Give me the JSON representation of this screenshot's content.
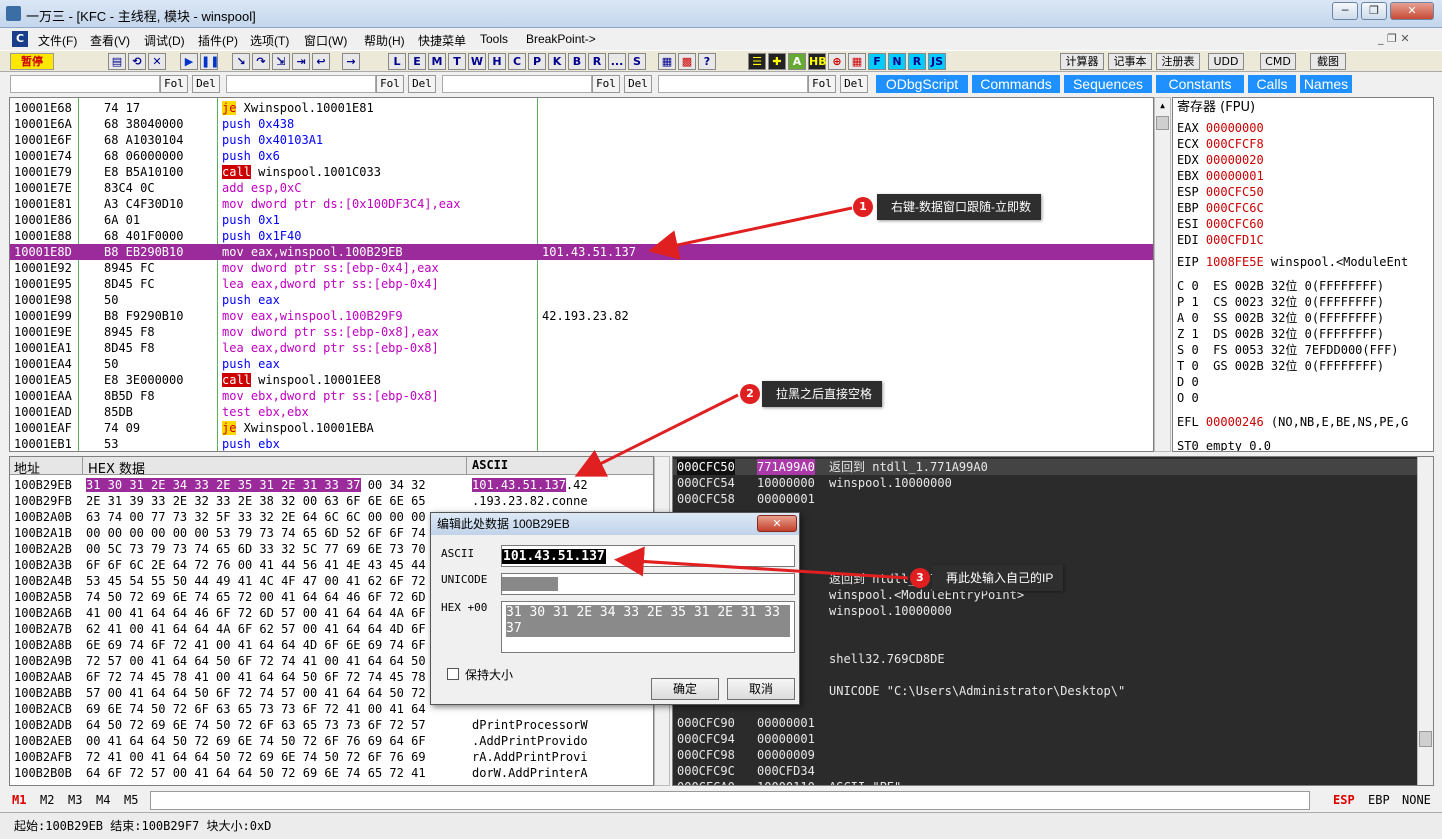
{
  "window": {
    "title": "一万三 - [KFC - 主线程, 模块 - winspool]"
  },
  "menubar": {
    "items": [
      "文件(F)",
      "查看(V)",
      "调试(D)",
      "插件(P)",
      "选项(T)",
      "窗口(W)",
      "帮助(H)",
      "快捷菜单",
      "Tools",
      "BreakPoint->"
    ]
  },
  "toolbar": {
    "pause_label": "暂停",
    "letters": [
      "L",
      "E",
      "M",
      "T",
      "W",
      "H",
      "C",
      "P",
      "K",
      "B",
      "R",
      "...",
      "S"
    ],
    "right_buttons": [
      "计算器",
      "记事本",
      "注册表",
      "UDD",
      "CMD",
      "截图"
    ],
    "fnrjs": [
      "F",
      "N",
      "R",
      "JS"
    ]
  },
  "bookmarks": {
    "fol": "Fol",
    "del": "Del",
    "plugins": [
      "ODbgScript",
      "Commands",
      "Sequences",
      "Constants",
      "Calls",
      "Names"
    ]
  },
  "disasm": {
    "rows": [
      {
        "addr": "10001E68",
        "hex": "74 17",
        "asm": "je Xwinspool.10001E81",
        "comment": ""
      },
      {
        "addr": "10001E6A",
        "hex": "68 38040000",
        "asm": "push 0x438",
        "comment": ""
      },
      {
        "addr": "10001E6F",
        "hex": "68 A1030104",
        "asm": "push 0x40103A1",
        "comment": ""
      },
      {
        "addr": "10001E74",
        "hex": "68 06000000",
        "asm": "push 0x6",
        "comment": ""
      },
      {
        "addr": "10001E79",
        "hex": "E8 B5A10100",
        "asm": "call winspool.1001C033",
        "comment": ""
      },
      {
        "addr": "10001E7E",
        "hex": "83C4 0C",
        "asm": "add esp,0xC",
        "comment": ""
      },
      {
        "addr": "10001E81",
        "hex": "A3 C4F30D10",
        "asm": "mov dword ptr ds:[0x100DF3C4],eax",
        "comment": ""
      },
      {
        "addr": "10001E86",
        "hex": "6A 01",
        "asm": "push 0x1",
        "comment": ""
      },
      {
        "addr": "10001E88",
        "hex": "68 401F0000",
        "asm": "push 0x1F40",
        "comment": ""
      },
      {
        "addr": "10001E8D",
        "hex": "B8 EB290B10",
        "asm": "mov eax,winspool.100B29EB",
        "comment": "101.43.51.137"
      },
      {
        "addr": "10001E92",
        "hex": "8945 FC",
        "asm": "mov dword ptr ss:[ebp-0x4],eax",
        "comment": ""
      },
      {
        "addr": "10001E95",
        "hex": "8D45 FC",
        "asm": "lea eax,dword ptr ss:[ebp-0x4]",
        "comment": ""
      },
      {
        "addr": "10001E98",
        "hex": "50",
        "asm": "push eax",
        "comment": ""
      },
      {
        "addr": "10001E99",
        "hex": "B8 F9290B10",
        "asm": "mov eax,winspool.100B29F9",
        "comment": "42.193.23.82"
      },
      {
        "addr": "10001E9E",
        "hex": "8945 F8",
        "asm": "mov dword ptr ss:[ebp-0x8],eax",
        "comment": ""
      },
      {
        "addr": "10001EA1",
        "hex": "8D45 F8",
        "asm": "lea eax,dword ptr ss:[ebp-0x8]",
        "comment": ""
      },
      {
        "addr": "10001EA4",
        "hex": "50",
        "asm": "push eax",
        "comment": ""
      },
      {
        "addr": "10001EA5",
        "hex": "E8 3E000000",
        "asm": "call winspool.10001EE8",
        "comment": ""
      },
      {
        "addr": "10001EAA",
        "hex": "8B5D F8",
        "asm": "mov ebx,dword ptr ss:[ebp-0x8]",
        "comment": ""
      },
      {
        "addr": "10001EAD",
        "hex": "85DB",
        "asm": "test ebx,ebx",
        "comment": ""
      },
      {
        "addr": "10001EAF",
        "hex": "74 09",
        "asm": "je Xwinspool.10001EBA",
        "comment": ""
      },
      {
        "addr": "10001EB1",
        "hex": "53",
        "asm": "push ebx",
        "comment": ""
      }
    ]
  },
  "registers": {
    "title": "寄存器 (FPU)",
    "gp": [
      {
        "name": "EAX",
        "val": "00000000"
      },
      {
        "name": "ECX",
        "val": "000CFCF8"
      },
      {
        "name": "EDX",
        "val": "00000020"
      },
      {
        "name": "EBX",
        "val": "00000001"
      },
      {
        "name": "ESP",
        "val": "000CFC50"
      },
      {
        "name": "EBP",
        "val": "000CFC6C"
      },
      {
        "name": "ESI",
        "val": "000CFC60"
      },
      {
        "name": "EDI",
        "val": "000CFD1C"
      }
    ],
    "eip": {
      "name": "EIP",
      "val": "1008FE5E",
      "extra": "winspool.<ModuleEnt"
    },
    "flags": [
      "C 0  ES 002B 32位 0(FFFFFFFF)",
      "P 1  CS 0023 32位 0(FFFFFFFF)",
      "A 0  SS 002B 32位 0(FFFFFFFF)",
      "Z 1  DS 002B 32位 0(FFFFFFFF)",
      "S 0  FS 0053 32位 7EFDD000(FFF)",
      "T 0  GS 002B 32位 0(FFFFFFFF)",
      "D 0",
      "O 0"
    ],
    "efl": {
      "name": "EFL",
      "val": "00000246",
      "extra": "(NO,NB,E,BE,NS,PE,G"
    },
    "st0": "ST0 empty 0.0"
  },
  "hexdump": {
    "headers": {
      "addr": "地址",
      "hex": "HEX 数据",
      "ascii": "ASCII"
    },
    "rows": [
      {
        "addr": "100B29EB",
        "hex": "31 30 31 2E 34 33 2E 35 31 2E 31 33 37 00 34 32",
        "ascii": "101.43.51.137.42"
      },
      {
        "addr": "100B29FB",
        "hex": "2E 31 39 33 2E 32 33 2E 38 32 00 63 6F 6E 6E 65",
        "ascii": ".193.23.82.conne"
      },
      {
        "addr": "100B2A0B",
        "hex": "63 74 00 77 73 32 5F 33 32 2E 64 6C 6C 00 00 00",
        "ascii": ""
      },
      {
        "addr": "100B2A1B",
        "hex": "00 00 00 00 00 00 53 79 73 74 65 6D 52 6F 6F 74",
        "ascii": ""
      },
      {
        "addr": "100B2A2B",
        "hex": "00 5C 73 79 73 74 65 6D 33 32 5C 77 69 6E 73 70",
        "ascii": ""
      },
      {
        "addr": "100B2A3B",
        "hex": "6F 6F 6C 2E 64 72 76 00 41 44 56 41 4E 43 45 44",
        "ascii": ""
      },
      {
        "addr": "100B2A4B",
        "hex": "53 45 54 55 50 44 49 41 4C 4F 47 00 41 62 6F 72",
        "ascii": ""
      },
      {
        "addr": "100B2A5B",
        "hex": "74 50 72 69 6E 74 65 72 00 41 64 64 46 6F 72 6D",
        "ascii": ""
      },
      {
        "addr": "100B2A6B",
        "hex": "41 00 41 64 64 46 6F 72 6D 57 00 41 64 64 4A 6F",
        "ascii": ""
      },
      {
        "addr": "100B2A7B",
        "hex": "62 41 00 41 64 64 4A 6F 62 57 00 41 64 64 4D 6F",
        "ascii": ""
      },
      {
        "addr": "100B2A8B",
        "hex": "6E 69 74 6F 72 41 00 41 64 64 4D 6F 6E 69 74 6F",
        "ascii": ""
      },
      {
        "addr": "100B2A9B",
        "hex": "72 57 00 41 64 64 50 6F 72 74 41 00 41 64 64 50",
        "ascii": ""
      },
      {
        "addr": "100B2AAB",
        "hex": "6F 72 74 45 78 41 00 41 64 64 50 6F 72 74 45 78",
        "ascii": ""
      },
      {
        "addr": "100B2ABB",
        "hex": "57 00 41 64 64 50 6F 72 74 57 00 41 64 64 50 72",
        "ascii": ""
      },
      {
        "addr": "100B2ACB",
        "hex": "69 6E 74 50 72 6F 63 65 73 73 6F 72 41 00 41 64",
        "ascii": ""
      },
      {
        "addr": "100B2ADB",
        "hex": "64 50 72 69 6E 74 50 72 6F 63 65 73 73 6F 72 57",
        "ascii": "dPrintProcessorW"
      },
      {
        "addr": "100B2AEB",
        "hex": "00 41 64 64 50 72 69 6E 74 50 72 6F 76 69 64 6F",
        "ascii": ".AddPrintProvido"
      },
      {
        "addr": "100B2AFB",
        "hex": "72 41 00 41 64 64 50 72 69 6E 74 50 72 6F 76 69",
        "ascii": "rA.AddPrintProvi"
      },
      {
        "addr": "100B2B0B",
        "hex": "64 6F 72 57 00 41 64 64 50 72 69 6E 74 65 72 41",
        "ascii": "dorW.AddPrinterA"
      }
    ]
  },
  "stack": {
    "rows": [
      {
        "addr": "000CFC50",
        "val": "771A99A0",
        "text": "返回到 ntdll_1.771A99A0"
      },
      {
        "addr": "000CFC54",
        "val": "10000000",
        "text": "winspool.10000000"
      },
      {
        "addr": "000CFC58",
        "val": "00000001",
        "text": ""
      },
      {
        "addr": "",
        "val": "",
        "text": ""
      },
      {
        "addr": "",
        "val": "",
        "text": ""
      },
      {
        "addr": "",
        "val": "",
        "text": ""
      },
      {
        "addr": "",
        "val": "",
        "text": ""
      },
      {
        "addr": "",
        "val": "",
        "text": "返回到 ntdll_1.771A998C"
      },
      {
        "addr": "",
        "val": "",
        "text": "winspool.<ModuleEntryPoint>"
      },
      {
        "addr": "",
        "val": "",
        "text": "winspool.10000000"
      },
      {
        "addr": "",
        "val": "",
        "text": ""
      },
      {
        "addr": "",
        "val": "",
        "text": ""
      },
      {
        "addr": "",
        "val": "",
        "text": "shell32.769CD8DE"
      },
      {
        "addr": "",
        "val": "",
        "text": ""
      },
      {
        "addr": "",
        "val": "",
        "text": "UNICODE \"C:\\Users\\Administrator\\Desktop\\\""
      },
      {
        "addr": "",
        "val": "",
        "text": ""
      },
      {
        "addr": "000CFC90",
        "val": "00000001",
        "text": ""
      },
      {
        "addr": "000CFC94",
        "val": "00000001",
        "text": ""
      },
      {
        "addr": "000CFC98",
        "val": "00000009",
        "text": ""
      },
      {
        "addr": "000CFC9C",
        "val": "000CFD34",
        "text": ""
      },
      {
        "addr": "000CFCA0",
        "val": "10000110",
        "text": "ASCII \"PE\""
      }
    ]
  },
  "dialog": {
    "title": "编辑此处数据 100B29EB",
    "ascii_label": "ASCII",
    "ascii_value": "101.43.51.137",
    "unicode_label": "UNICODE",
    "hex_label": "HEX +00",
    "hex_value": "31 30 31 2E 34 33 2E 35 31 2E 31 33 37",
    "keep_size": "保持大小",
    "ok": "确定",
    "cancel": "取消"
  },
  "callouts": [
    {
      "num": "1",
      "text": "右键-数据窗口跟随-立即数"
    },
    {
      "num": "2",
      "text": "拉黑之后直接空格"
    },
    {
      "num": "3",
      "text": "再此处输入自己的IP"
    }
  ],
  "cmdbar": {
    "tabs": [
      "M1",
      "M2",
      "M3",
      "M4",
      "M5"
    ],
    "right": [
      "ESP",
      "EBP",
      "NONE"
    ]
  },
  "status": {
    "text": "起始:100B29EB 结束:100B29F7 块大小:0xD"
  },
  "colors": {
    "selection": "#9b2a9b",
    "asm_purple": "#c000c0",
    "register_red": "#cc0000",
    "callout_bg": "#2e2e2e",
    "badge_red": "#e02020"
  }
}
